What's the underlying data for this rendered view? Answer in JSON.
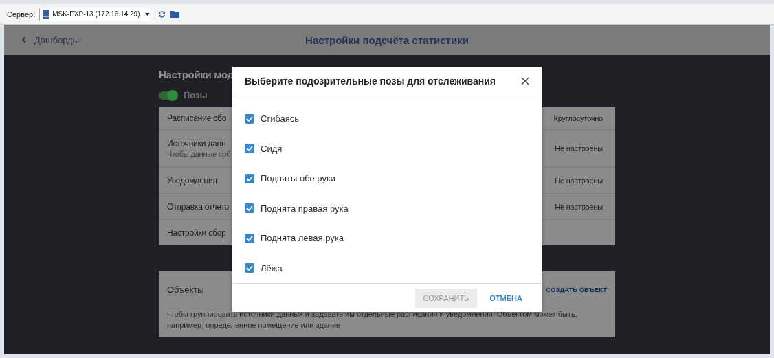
{
  "toolbar": {
    "server_label": "Сервер:",
    "server_value": "MSK-EXP-13 (172.16.14.29)"
  },
  "header": {
    "back": "Дашборды",
    "title": "Настройки подсчёта статистики"
  },
  "section": {
    "title": "Настройки мод",
    "toggle": {
      "label": "Позы",
      "on": true
    }
  },
  "settings": [
    {
      "label": "Расписание сбо",
      "value": "Круглосуточно"
    },
    {
      "label": "Источники данн",
      "hint": "Чтобы данные соб",
      "value": "Не настроены"
    },
    {
      "label": "Уведомления",
      "value": "Не настроены"
    },
    {
      "label": "Отправка отчето",
      "value": "Не настроены"
    },
    {
      "label": "Настройки сбор"
    }
  ],
  "objects": {
    "title": "Объекты",
    "action": "СОЗДАТЬ ОБЪЕКТ",
    "description": "чтобы группировать источники данных и задавать им отдельные расписания и уведомления. Объектом может быть, например, определенное помещение или здание"
  },
  "dialog": {
    "title": "Выберите подозрительные позы для отслеживания",
    "options": [
      {
        "label": "Сгибаясь",
        "checked": true
      },
      {
        "label": "Сидя",
        "checked": true
      },
      {
        "label": "Подняты обе руки",
        "checked": true
      },
      {
        "label": "Поднята правая рука",
        "checked": true
      },
      {
        "label": "Поднята левая рука",
        "checked": true
      },
      {
        "label": "Лёжа",
        "checked": true
      }
    ],
    "save": {
      "label": "СОХРАНИТЬ",
      "disabled": true
    },
    "cancel": "ОТМЕНА"
  }
}
